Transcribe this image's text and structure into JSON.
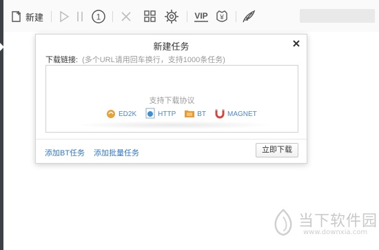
{
  "toolbar": {
    "new_label": "新建",
    "icons": [
      "new-task-icon",
      "play-icon",
      "pause-icon",
      "speed-limit-icon",
      "delete-icon",
      "grid-icon",
      "settings-icon",
      "vip-icon",
      "yuan-icon",
      "feather-icon"
    ],
    "vip_text": "VIP",
    "speed_text": "1",
    "yuan_text": "¥"
  },
  "dialog": {
    "title": "新建任务",
    "link_label": "下载链接:",
    "link_hint": "(多个URL请用回车换行，支持1000条任务)",
    "supported_title": "支持下载协议",
    "protocols": [
      {
        "name": "ED2K",
        "icon": "ed2k-icon"
      },
      {
        "name": "HTTP",
        "icon": "http-icon"
      },
      {
        "name": "BT",
        "icon": "bt-icon"
      },
      {
        "name": "MAGNET",
        "icon": "magnet-icon"
      }
    ],
    "add_bt_label": "添加BT任务",
    "add_batch_label": "添加批量任务",
    "download_now_label": "立即下载"
  },
  "watermark": {
    "text": "当下软件园",
    "url": "www.downxia.com"
  },
  "colors": {
    "link_blue": "#2f77c8",
    "protocol_blue": "#4d87c7",
    "left_strip": "#3d4147"
  }
}
